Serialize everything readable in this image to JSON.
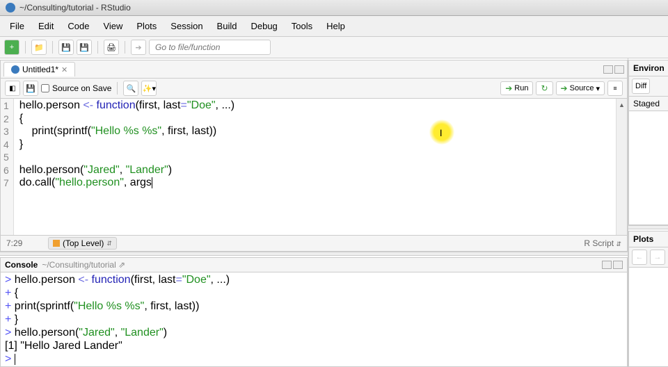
{
  "window": {
    "title": "~/Consulting/tutorial - RStudio"
  },
  "menus": [
    "File",
    "Edit",
    "Code",
    "View",
    "Plots",
    "Session",
    "Build",
    "Debug",
    "Tools",
    "Help"
  ],
  "toolbar": {
    "goto_placeholder": "Go to file/function"
  },
  "editor": {
    "tab_label": "Untitled1*",
    "source_on_save": "Source on Save",
    "run_label": "Run",
    "source_label": "Source",
    "lines": [
      {
        "n": "1",
        "html": "hello.person <span class='s-op'>&lt;-</span> <span class='s-key'>function</span>(first, last<span class='s-op'>=</span><span class='s-str'>\"Doe\"</span>, ...)"
      },
      {
        "n": "2",
        "html": "{"
      },
      {
        "n": "3",
        "html": "    print(sprintf(<span class='s-str'>\"Hello %s %s\"</span>, first, last))"
      },
      {
        "n": "4",
        "html": "}"
      },
      {
        "n": "5",
        "html": ""
      },
      {
        "n": "6",
        "html": "hello.person(<span class='s-str'>\"Jared\"</span>, <span class='s-str'>\"Lander\"</span>)"
      },
      {
        "n": "7",
        "html": "do.call(<span class='s-str'>\"hello.person\"</span>, args"
      }
    ]
  },
  "status": {
    "pos": "7:29",
    "scope": "(Top Level)",
    "lang": "R Script"
  },
  "console": {
    "title": "Console",
    "path": "~/Consulting/tutorial",
    "lines": [
      {
        "p": ">",
        "html": "hello.person <span class='s-op'>&lt;-</span> <span class='s-key'>function</span>(first, last<span class='s-op'>=</span><span class='s-str'>\"Doe\"</span>, ...)"
      },
      {
        "p": "+",
        "html": "{"
      },
      {
        "p": "+",
        "html": "    print(sprintf(<span class='s-str'>\"Hello %s %s\"</span>, first, last))"
      },
      {
        "p": "+",
        "html": "}"
      },
      {
        "p": ">",
        "html": "hello.person(<span class='s-str'>\"Jared\"</span>, <span class='s-str'>\"Lander\"</span>)"
      },
      {
        "p": "",
        "html": "[1] \"Hello Jared Lander\""
      },
      {
        "p": ">",
        "html": "<span class='caret'></span>"
      }
    ]
  },
  "right": {
    "top_tab": "Environ",
    "top_btn1": "Diff",
    "top_row2": "Staged",
    "bottom_tab": "Plots"
  }
}
